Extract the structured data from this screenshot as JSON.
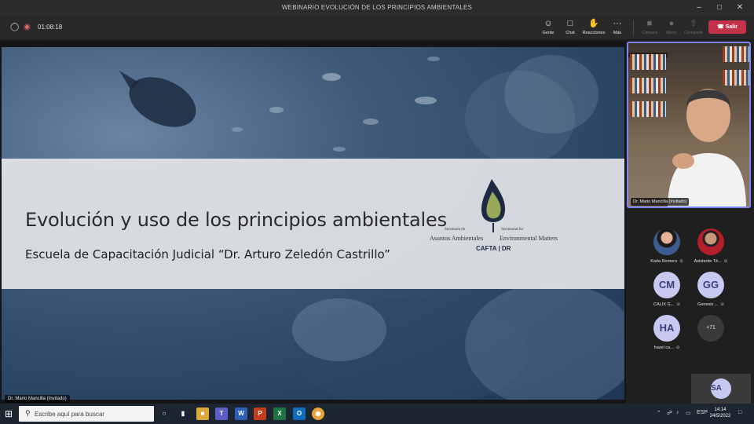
{
  "window": {
    "title": "WEBINARIO EVOLUCIÓN DE LOS PRINCIPIOS AMBIENTALES"
  },
  "meeting": {
    "timer": "01:08:18",
    "tools": [
      {
        "label": "Gente",
        "icon": "people-icon"
      },
      {
        "label": "Chat",
        "icon": "chat-icon"
      },
      {
        "label": "Reacciones",
        "icon": "reactions-icon"
      },
      {
        "label": "Más",
        "icon": "more-icon"
      },
      {
        "label": "Cámara",
        "icon": "camera-icon"
      },
      {
        "label": "Micro",
        "icon": "mic-icon"
      },
      {
        "label": "Compartir",
        "icon": "share-icon"
      }
    ],
    "leave_label": "Salir"
  },
  "slide": {
    "title": "Evolución y uso de los principios ambientales",
    "subtitle": "Escuela de Capacitación Judicial “Dr. Arturo Zeledón Castrillo”",
    "logo": {
      "line1_es": "Secretaría de",
      "line2_es": "Asuntos Ambientales",
      "line1_en": "Secretariat for",
      "line2_en": "Environmental Matters",
      "footer": "CAFTA | DR"
    },
    "presenter_label": "Dr. Mario Mancilla (Invitado)"
  },
  "speaker": {
    "name": "Dr. Mario Mancilla (Invitado)"
  },
  "participants": [
    {
      "name": "Karla Romero",
      "initials": "",
      "kind": "photo"
    },
    {
      "name": "Asistente Té...",
      "initials": "",
      "kind": "photo2"
    },
    {
      "name": "CALIX G...",
      "initials": "CM",
      "kind": "initials"
    },
    {
      "name": "Genesis ...",
      "initials": "GG",
      "kind": "initials"
    },
    {
      "name": "hazel ca...",
      "initials": "HA",
      "kind": "initials"
    },
    {
      "name": "",
      "initials": "+71",
      "kind": "more"
    }
  ],
  "self": {
    "initials": "SA"
  },
  "taskbar": {
    "search_placeholder": "Escribe aquí para buscar",
    "lang": "ESP",
    "time": "14:14",
    "date": "24/5/2022"
  }
}
